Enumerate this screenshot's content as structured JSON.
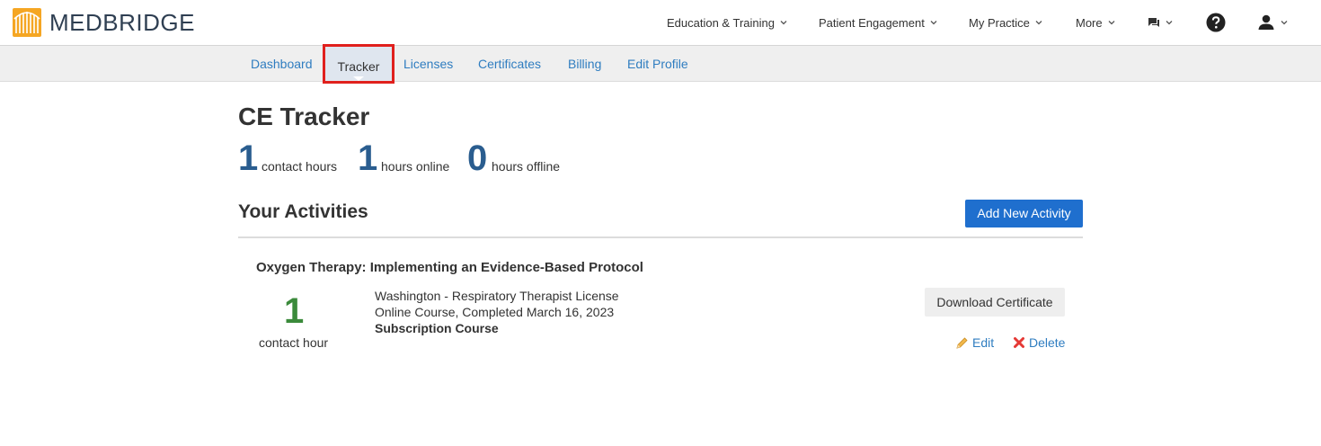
{
  "brand": {
    "name": "MEDBRIDGE",
    "logo_color": "#f5a623",
    "text_color": "#2f3f52"
  },
  "topnav": {
    "education": "Education & Training",
    "patient": "Patient Engagement",
    "practice": "My Practice",
    "more": "More",
    "chat_icon": "chat-icon",
    "help_icon": "help-icon",
    "user_icon": "user-icon"
  },
  "subnav": {
    "items": [
      "Dashboard",
      "Tracker",
      "Licenses",
      "Certificates",
      "Billing",
      "Edit Profile"
    ],
    "active": "Tracker",
    "highlight_color": "#e0201d"
  },
  "page": {
    "title": "CE Tracker",
    "stats": [
      {
        "value": "1",
        "label": "contact hours"
      },
      {
        "value": "1",
        "label": "hours online"
      },
      {
        "value": "0",
        "label": "hours offline"
      }
    ]
  },
  "activities": {
    "title": "Your Activities",
    "add_button": "Add New Activity",
    "items": [
      {
        "title": "Oxygen Therapy: Implementing an Evidence-Based Protocol",
        "hours": "1",
        "unit": "contact hour",
        "license": "Washington - Respiratory Therapist License",
        "status": "Online Course, Completed March 16, 2023",
        "type": "Subscription Course",
        "download_label": "Download Certificate",
        "edit_label": "Edit",
        "delete_label": "Delete"
      }
    ]
  },
  "colors": {
    "accent": "#1f6fce",
    "link": "#2f7dc0",
    "stat": "#2a5d8f",
    "hours": "#3b8a3b",
    "delete": "#e53935"
  }
}
